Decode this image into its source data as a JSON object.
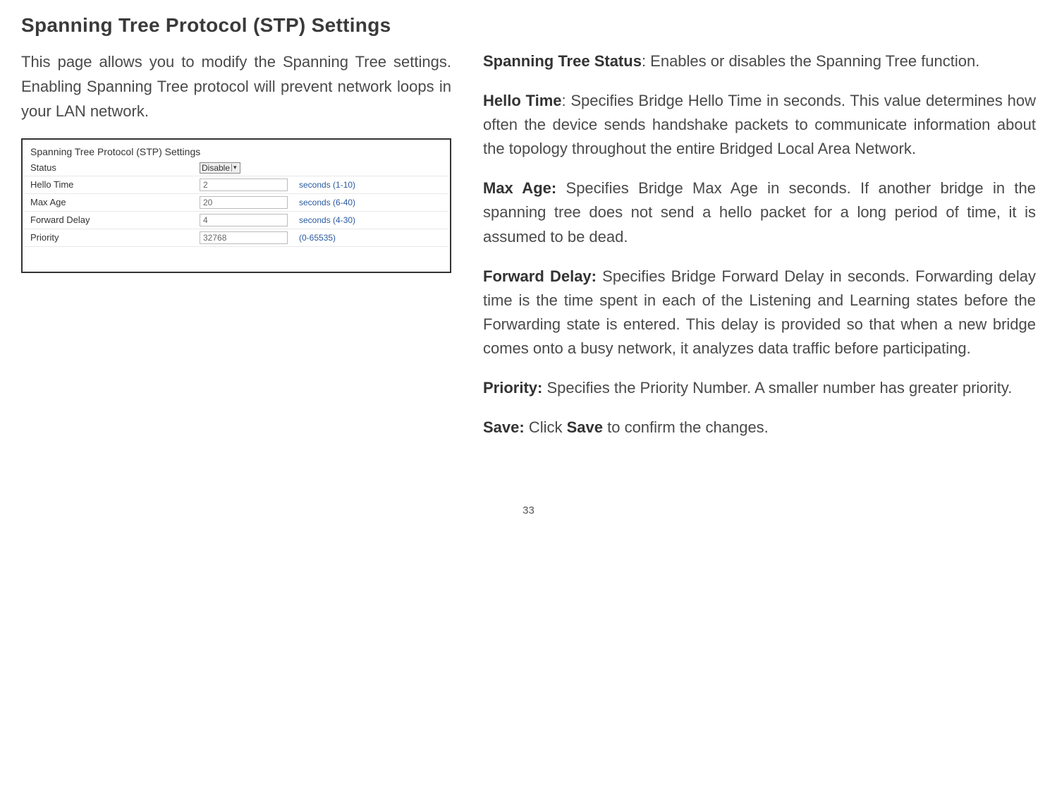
{
  "title": "Spanning Tree Protocol (STP) Settings",
  "intro": "This page allows you to modify the Spanning Tree settings. Enabling Spanning Tree protocol will prevent network loops in your LAN network.",
  "form": {
    "heading": "Spanning Tree Protocol (STP) Settings",
    "rows": [
      {
        "label": "Status",
        "type": "select",
        "value": "Disable",
        "note": ""
      },
      {
        "label": "Hello Time",
        "type": "input",
        "value": "2",
        "note": "seconds (1-10)"
      },
      {
        "label": "Max Age",
        "type": "input",
        "value": "20",
        "note": "seconds (6-40)"
      },
      {
        "label": "Forward Delay",
        "type": "input",
        "value": "4",
        "note": "seconds (4-30)"
      },
      {
        "label": "Priority",
        "type": "input",
        "value": "32768",
        "note": "(0-65535)"
      }
    ]
  },
  "definitions": {
    "status": {
      "label": "Spanning Tree Status",
      "text": ": Enables or disables the Spanning Tree function."
    },
    "hello": {
      "label": "Hello Time",
      "text": ": Specifies Bridge Hello Time in seconds. This value determines how often the device sends handshake packets to communicate information about the topology throughout the entire Bridged Local Area Network."
    },
    "maxage": {
      "label": "Max Age:",
      "text": " Specifies Bridge Max Age in seconds. If another bridge in the spanning tree does not send a hello packet for a long period of time, it is assumed to be dead."
    },
    "forward": {
      "label": "Forward Delay:",
      "text": " Specifies Bridge Forward Delay in seconds. Forwarding delay time is the time spent in each of the Listening and Learning states before the Forwarding state is entered. This delay is provided so that when a new bridge comes onto a busy network, it analyzes data traffic before participating."
    },
    "priority": {
      "label": "Priority:",
      "text": " Specifies the Priority Number. A smaller number has greater priority."
    },
    "save": {
      "label": "Save:",
      "text_pre": " Click ",
      "label2": "Save",
      "text_post": " to confirm the changes."
    }
  },
  "page_number": "33"
}
